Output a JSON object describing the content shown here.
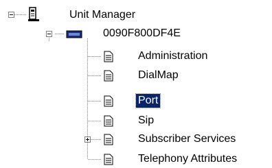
{
  "tree": {
    "root": {
      "label": "Unit Manager",
      "icon": "phone-icon",
      "expanded": true
    },
    "unit": {
      "label": "0090F800DF4E",
      "icon": "unit-device-icon",
      "expanded": true
    },
    "items": [
      {
        "label": "Administration",
        "icon": "document-icon",
        "selected": false
      },
      {
        "label": "DialMap",
        "icon": "document-icon",
        "selected": false
      },
      {
        "label": "Port",
        "icon": "document-icon",
        "selected": true
      },
      {
        "label": "Sip",
        "icon": "document-icon",
        "selected": false
      },
      {
        "label": "Subscriber Services",
        "icon": "document-icon",
        "selected": false,
        "expandable": true
      },
      {
        "label": "Telephony Attributes",
        "icon": "document-icon",
        "selected": false
      }
    ]
  }
}
